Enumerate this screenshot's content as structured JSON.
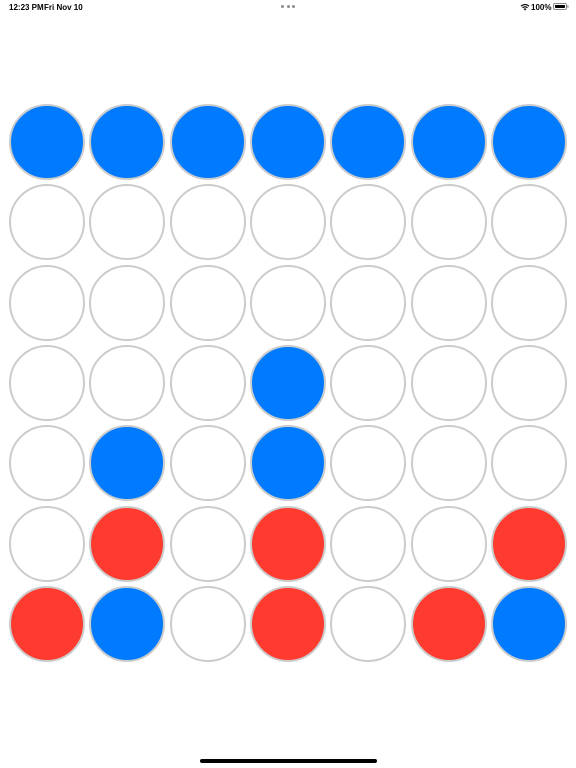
{
  "status_bar": {
    "time": "12:23 PM",
    "date": "Fri Nov 10",
    "battery": "100%"
  },
  "colors": {
    "blue": "#007aff",
    "red": "#ff3b30",
    "empty": "#ffffff",
    "cell_border": "#cccccc"
  },
  "board": {
    "columns": 7,
    "rows": [
      [
        "blue",
        "blue",
        "blue",
        "blue",
        "blue",
        "blue",
        "blue"
      ],
      [
        "empty",
        "empty",
        "empty",
        "empty",
        "empty",
        "empty",
        "empty"
      ],
      [
        "empty",
        "empty",
        "empty",
        "empty",
        "empty",
        "empty",
        "empty"
      ],
      [
        "empty",
        "empty",
        "empty",
        "blue",
        "empty",
        "empty",
        "empty"
      ],
      [
        "empty",
        "blue",
        "empty",
        "blue",
        "empty",
        "empty",
        "empty"
      ],
      [
        "empty",
        "red",
        "empty",
        "red",
        "empty",
        "empty",
        "red"
      ],
      [
        "red",
        "blue",
        "empty",
        "red",
        "empty",
        "red",
        "blue"
      ]
    ]
  }
}
